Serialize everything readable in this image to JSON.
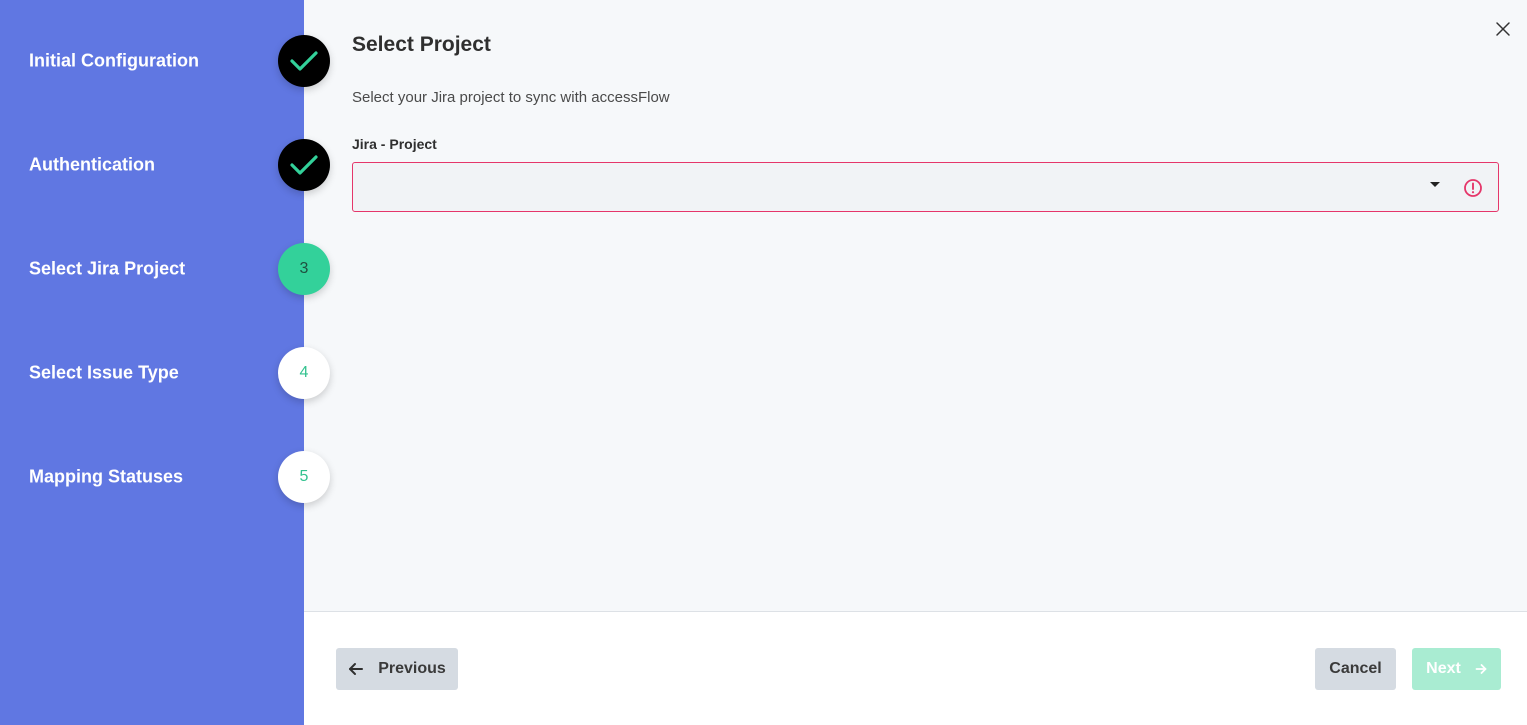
{
  "sidebar": {
    "steps": [
      {
        "label": "Initial Configuration",
        "status": "done",
        "icon": "check-icon"
      },
      {
        "label": "Authentication",
        "status": "done",
        "icon": "check-icon"
      },
      {
        "label": "Select Jira Project",
        "status": "active",
        "number": "3"
      },
      {
        "label": "Select Issue Type",
        "status": "pending",
        "number": "4"
      },
      {
        "label": "Mapping Statuses",
        "status": "pending",
        "number": "5"
      }
    ]
  },
  "main": {
    "title": "Select Project",
    "subtitle": "Select your Jira project to sync with accessFlow",
    "field_label": "Jira - Project",
    "select_value": ""
  },
  "footer": {
    "previous_label": "Previous",
    "cancel_label": "Cancel",
    "next_label": "Next"
  },
  "colors": {
    "sidebar_bg": "#6077e2",
    "accent_green": "#33d19a",
    "error_red": "#e5366a",
    "next_disabled": "#a9ecd2"
  }
}
